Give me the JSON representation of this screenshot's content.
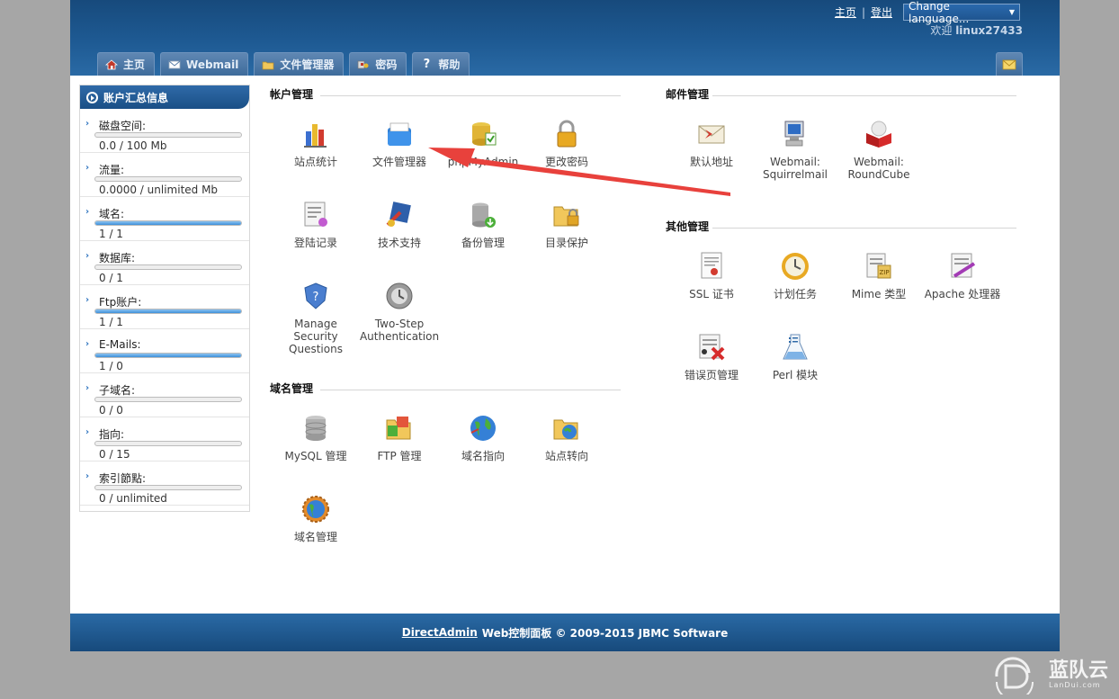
{
  "header": {
    "home_link": "主页",
    "logout_link": "登出",
    "separator": "|",
    "language_select": "Change language...",
    "welcome_text": "欢迎",
    "username": "linux27433",
    "tabs": [
      {
        "label": "主页",
        "icon": "home-icon"
      },
      {
        "label": "Webmail",
        "icon": "envelope-icon"
      },
      {
        "label": "文件管理器",
        "icon": "folder-icon"
      },
      {
        "label": "密码",
        "icon": "key-icon"
      },
      {
        "label": "帮助",
        "icon": "question-icon"
      }
    ],
    "mail_tab_icon": "mail-icon"
  },
  "sidebar": {
    "title": "账户汇总信息",
    "stats": [
      {
        "label": "磁盘空间:",
        "value": "0.0 / 100 Mb",
        "fill": 0
      },
      {
        "label": "流量:",
        "value": "0.0000 / unlimited Mb",
        "fill": 0
      },
      {
        "label": "域名:",
        "value": "1 / 1",
        "fill": 1
      },
      {
        "label": "数据库:",
        "value": "0 / 1",
        "fill": 0
      },
      {
        "label": "Ftp账户:",
        "value": "1 / 1",
        "fill": 1
      },
      {
        "label": "E-Mails:",
        "value": "1 / 0",
        "fill": 1
      },
      {
        "label": "子域名:",
        "value": "0 / 0",
        "fill": 0
      },
      {
        "label": "指向:",
        "value": "0 / 15",
        "fill": 0
      },
      {
        "label": "索引節點:",
        "value": "0 / unlimited",
        "fill": 0
      }
    ]
  },
  "account_section": {
    "title": "帐户管理",
    "items": [
      {
        "label": "站点统计",
        "icon": "stats-icon"
      },
      {
        "label": "文件管理器",
        "icon": "file-manager-icon"
      },
      {
        "label": "phpMyAdmin",
        "icon": "phpmyadmin-icon"
      },
      {
        "label": "更改密码",
        "icon": "lock-icon"
      },
      {
        "label": "登陆记录",
        "icon": "login-log-icon"
      },
      {
        "label": "技术支持",
        "icon": "support-icon"
      },
      {
        "label": "备份管理",
        "icon": "backup-icon"
      },
      {
        "label": "目录保护",
        "icon": "folder-lock-icon"
      },
      {
        "label": "Manage Security Questions",
        "icon": "shield-icon"
      },
      {
        "label": "Two-Step Authentication",
        "icon": "two-step-icon"
      }
    ]
  },
  "domain_section": {
    "title": "域名管理",
    "items": [
      {
        "label": "MySQL 管理",
        "icon": "database-icon"
      },
      {
        "label": "FTP 管理",
        "icon": "ftp-icon"
      },
      {
        "label": "域名指向",
        "icon": "globe-icon"
      },
      {
        "label": "站点转向",
        "icon": "redirect-icon"
      },
      {
        "label": "域名管理",
        "icon": "domain-gear-icon"
      }
    ]
  },
  "mail_section": {
    "title": "邮件管理",
    "items": [
      {
        "label": "默认地址",
        "icon": "default-address-icon"
      },
      {
        "label": "Webmail: Squirrelmail",
        "icon": "squirrelmail-icon"
      },
      {
        "label": "Webmail: RoundCube",
        "icon": "roundcube-icon"
      }
    ]
  },
  "other_section": {
    "title": "其他管理",
    "items": [
      {
        "label": "SSL 证书",
        "icon": "certificate-icon"
      },
      {
        "label": "计划任务",
        "icon": "clock-icon"
      },
      {
        "label": "Mime 类型",
        "icon": "mime-icon"
      },
      {
        "label": "Apache 处理器",
        "icon": "apache-icon"
      },
      {
        "label": "错误页管理",
        "icon": "error-page-icon"
      },
      {
        "label": "Perl 模块",
        "icon": "perl-icon"
      }
    ]
  },
  "footer": {
    "link": "DirectAdmin",
    "text": "Web控制面板 © 2009-2015 JBMC Software"
  },
  "watermark": {
    "text": "蓝队云",
    "sub": "LanDui.com"
  },
  "colors": {
    "header": "#1e5a93",
    "arrow": "#e8413c",
    "page_bg": "#a6a6a6"
  }
}
